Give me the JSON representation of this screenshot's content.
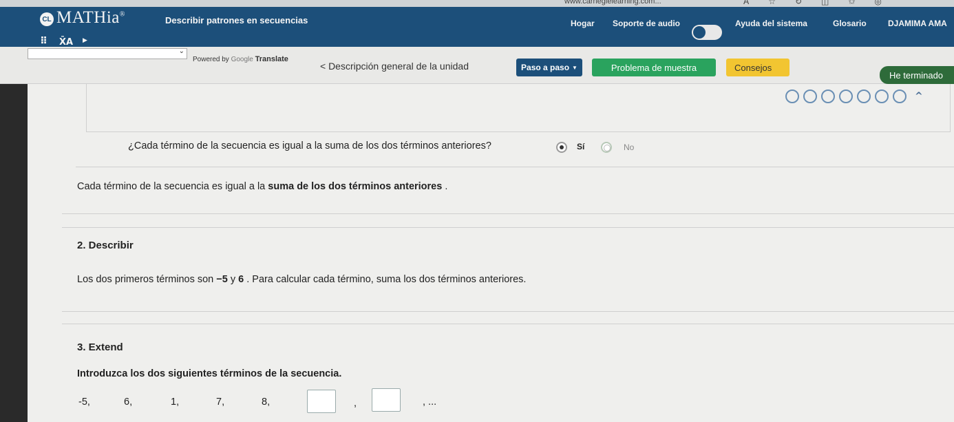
{
  "browser": {
    "url": "www.carnegielearning.com..."
  },
  "header": {
    "logo_badge": "CL",
    "logo_text": "MATHia",
    "logo_mark": "®",
    "page_title": "Describir patrones en secuencias",
    "nav": {
      "home": "Hogar",
      "audio": "Soporte de audio",
      "help": "Ayuda del sistema",
      "glossary": "Glosario",
      "user": "DJAMIMA AMA"
    }
  },
  "toolbar": {
    "powered_by": "Powered by",
    "google": "Google",
    "translate": "Translate",
    "overview_link": "< Descripción general de la unidad",
    "step_by_step": "Paso a paso",
    "sample_problem": "Problema de muestra",
    "hints": "Consejos",
    "done": "He terminado"
  },
  "progress": {
    "total_steps": 7,
    "completed": 0
  },
  "section1": {
    "question": "¿Cada término de la secuencia es igual a la suma de los dos términos anteriores?",
    "option_yes": "Sí",
    "option_no": "No",
    "selected": "Sí",
    "statement_prefix": "Cada término de la secuencia es igual a la ",
    "statement_bold": "suma de los dos términos anteriores",
    "statement_suffix": " ."
  },
  "section2": {
    "title": "2. Describir",
    "text_prefix": "Los dos primeros términos son ",
    "term1": "−5",
    "text_mid": " y ",
    "term2": "6",
    "text_suffix": " . Para calcular cada término, suma los dos términos anteriores."
  },
  "section3": {
    "title": "3. Extend",
    "instruction": "Introduzca los dos siguientes términos de la secuencia.",
    "terms": [
      "-5,",
      "6,",
      "1,",
      "7,",
      "8,"
    ],
    "separator": ",",
    "ellipsis": ", ..."
  }
}
